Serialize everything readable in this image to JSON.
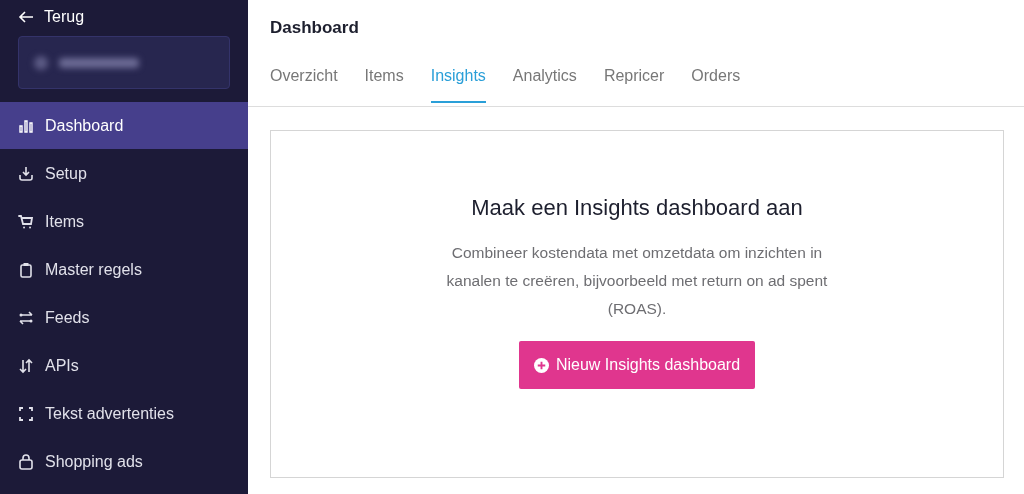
{
  "sidebar": {
    "back_label": "Terug",
    "account": {
      "kind": "blurred"
    },
    "items": [
      {
        "label": "Dashboard",
        "selected": true
      },
      {
        "label": "Setup",
        "selected": false
      },
      {
        "label": "Items",
        "selected": false
      },
      {
        "label": "Master regels",
        "selected": false
      },
      {
        "label": "Feeds",
        "selected": false
      },
      {
        "label": "APIs",
        "selected": false
      },
      {
        "label": "Tekst advertenties",
        "selected": false
      },
      {
        "label": "Shopping ads",
        "selected": false
      }
    ]
  },
  "header": {
    "title": "Dashboard"
  },
  "tabs": [
    {
      "label": "Overzicht",
      "selected": false
    },
    {
      "label": "Items",
      "selected": false
    },
    {
      "label": "Insights",
      "selected": true
    },
    {
      "label": "Analytics",
      "selected": false
    },
    {
      "label": "Repricer",
      "selected": false
    },
    {
      "label": "Orders",
      "selected": false
    }
  ],
  "empty_state": {
    "heading": "Maak een Insights dashboard aan",
    "description": "Combineer kostendata met omzetdata om inzichten in kanalen te creëren, bijvoorbeeld met return on ad spent (ROAS).",
    "button": "Nieuw Insights dashboard"
  }
}
